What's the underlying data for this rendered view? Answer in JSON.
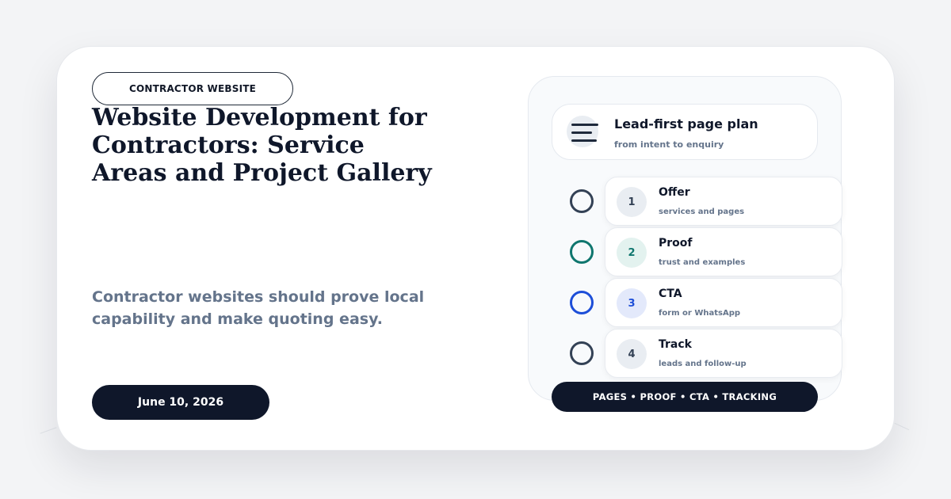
{
  "badge": "CONTRACTOR WEBSITE",
  "title": "Website Development for Contractors: Service Areas and Project Gallery",
  "subtitle": "Contractor websites should prove local capability and make quoting easy.",
  "date": "June 10, 2026",
  "plan": {
    "title": "Lead-first page plan",
    "subtitle": "from intent to enquiry",
    "icon": "menu-lines-icon"
  },
  "steps": [
    {
      "number": "1",
      "title": "Offer",
      "subtitle": "services and pages",
      "color": "#334155",
      "badge_bg": "#e9edf2"
    },
    {
      "number": "2",
      "title": "Proof",
      "subtitle": "trust and examples",
      "color": "#0f766e",
      "badge_bg": "#e3f2ef"
    },
    {
      "number": "3",
      "title": "CTA",
      "subtitle": "form or WhatsApp",
      "color": "#1d4ed8",
      "badge_bg": "#e3e9fb"
    },
    {
      "number": "4",
      "title": "Track",
      "subtitle": "leads and follow-up",
      "color": "#334155",
      "badge_bg": "#e9edf2"
    }
  ],
  "footer": "PAGES • PROOF • CTA • TRACKING"
}
